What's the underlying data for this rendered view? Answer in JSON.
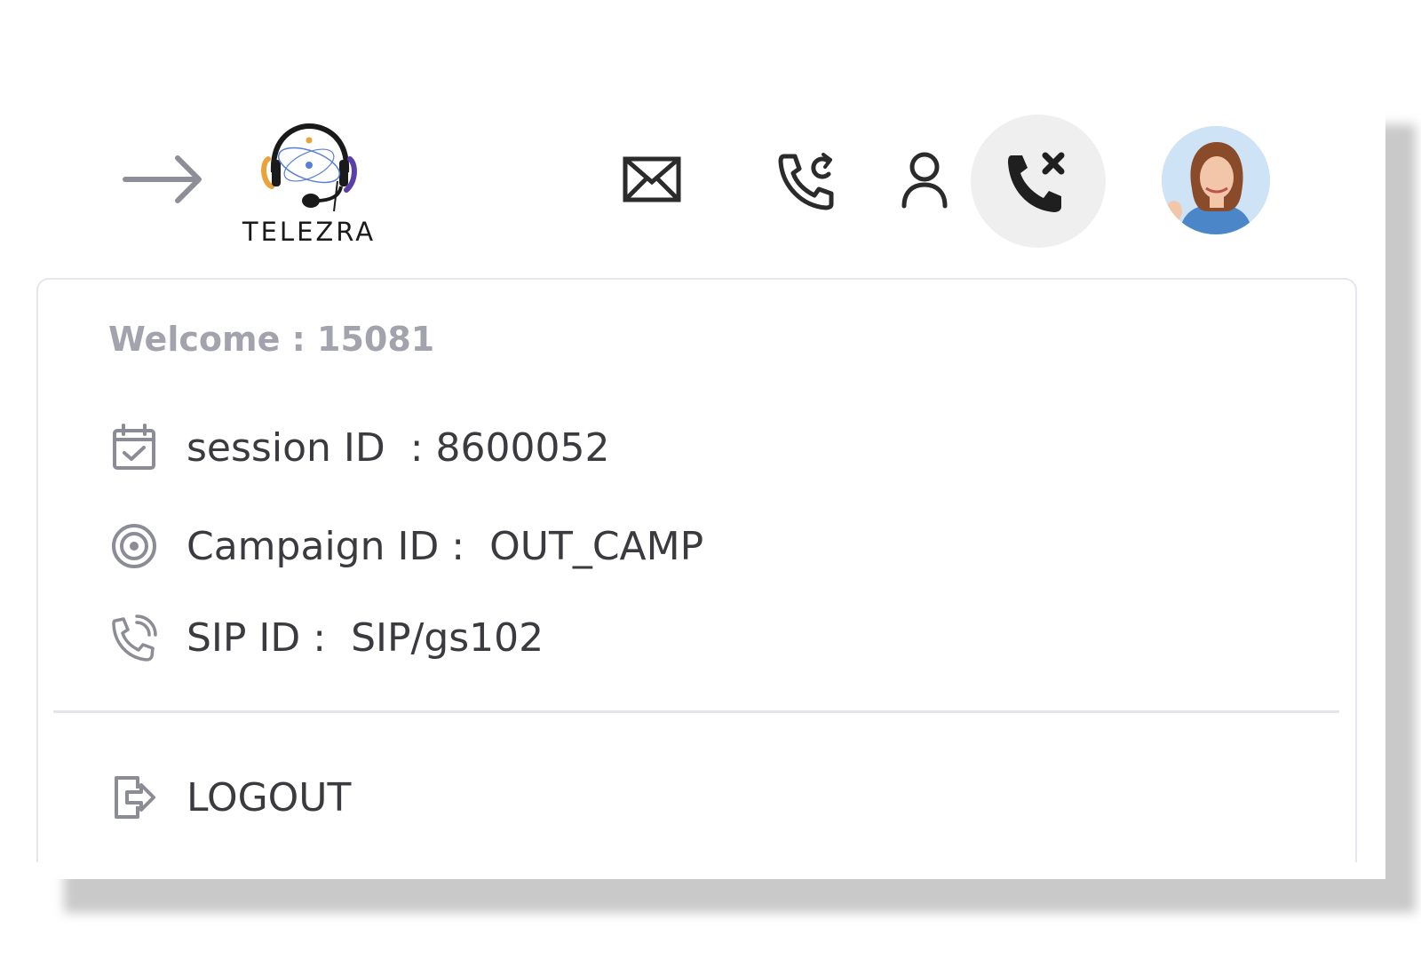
{
  "brand": {
    "name": "TELEZRA"
  },
  "header": {
    "icons": [
      "arrow-right-icon",
      "envelope-icon",
      "phone-callback-icon",
      "user-icon",
      "phone-hangup-icon"
    ],
    "hangup_bg": "#efefef"
  },
  "profile_menu": {
    "welcome": "Welcome : 15081",
    "session_label": "session ID  : 8600052",
    "campaign_label": "Campaign ID :  OUT_CAMP",
    "sip_label": "SIP ID :  SIP/gs102",
    "logout_label": "LOGOUT"
  },
  "colors": {
    "muted_text": "#a3a3ad",
    "body_text": "#3a3a3f",
    "icon_gray": "#8c8c96",
    "logo_orange": "#e8a33a",
    "logo_purple": "#5b3fa8",
    "logo_blue": "#5a7fd6"
  }
}
